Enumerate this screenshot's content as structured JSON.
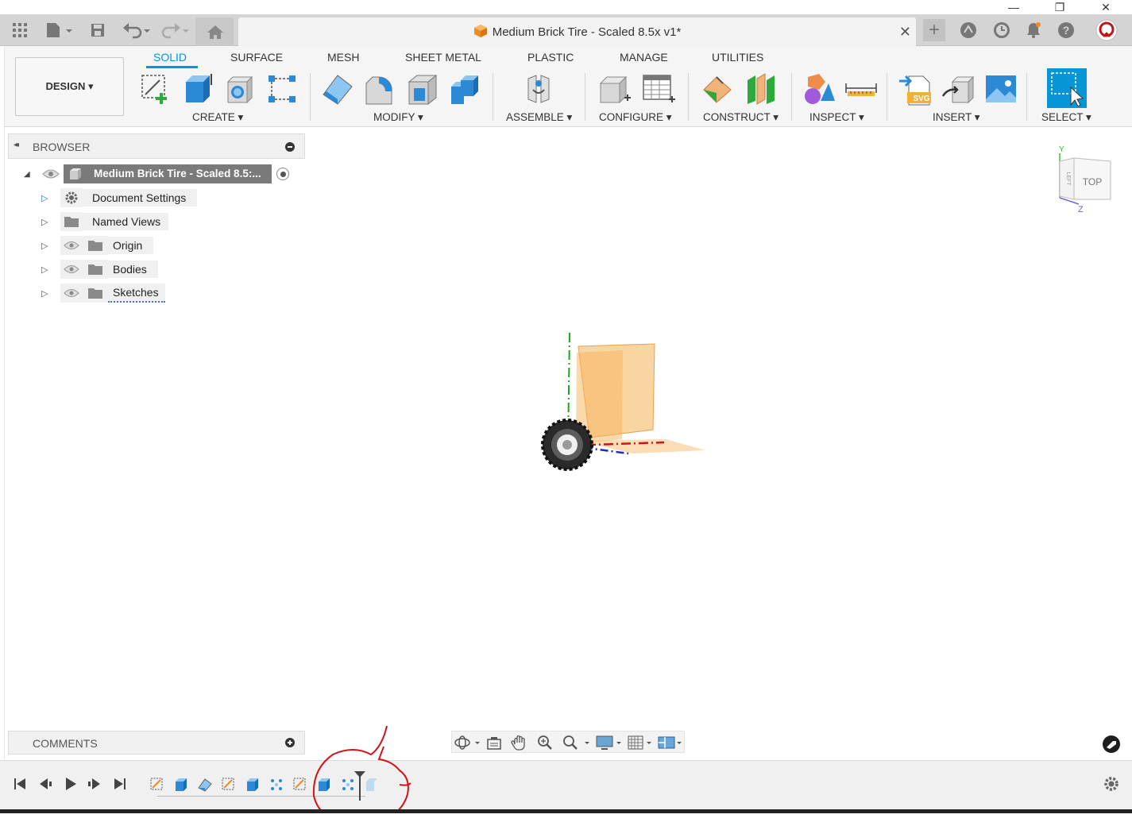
{
  "window": {
    "minimize_glyph": "—",
    "restore_glyph": "❐",
    "close_glyph": "✕"
  },
  "tabbar": {
    "document_title": "Medium Brick Tire - Scaled 8.5x v1*",
    "close_glyph": "✕",
    "new_tab_glyph": "+",
    "icons": [
      "grid-icon",
      "file-icon",
      "save-icon",
      "undo-icon",
      "redo-icon",
      "home-icon",
      "extensions-icon",
      "job-status-icon",
      "notifications-icon",
      "help-icon",
      "user-avatar-icon"
    ]
  },
  "ribbon": {
    "workspace": "DESIGN ▾",
    "tabs": [
      {
        "label": "SOLID",
        "active": true
      },
      {
        "label": "SURFACE"
      },
      {
        "label": "MESH"
      },
      {
        "label": "SHEET METAL"
      },
      {
        "label": "PLASTIC"
      },
      {
        "label": "MANAGE"
      },
      {
        "label": "UTILITIES"
      }
    ],
    "groups": {
      "create": "CREATE ▾",
      "modify": "MODIFY ▾",
      "assemble": "ASSEMBLE ▾",
      "configure": "CONFIGURE ▾",
      "construct": "CONSTRUCT ▾",
      "inspect": "INSPECT ▾",
      "insert": "INSERT ▾",
      "select": "SELECT ▾"
    },
    "svg_badge": "SVG",
    "accent_color": "#0696d7"
  },
  "browser": {
    "header": "BROWSER",
    "collapse_glyph": "◂◂",
    "root": "Medium Brick Tire - Scaled 8.5:...",
    "items": [
      {
        "label": "Document Settings"
      },
      {
        "label": "Named Views"
      },
      {
        "label": "Origin"
      },
      {
        "label": "Bodies"
      },
      {
        "label": "Sketches"
      }
    ]
  },
  "viewcube": {
    "top": "TOP",
    "left": "LEFT",
    "axis_y": "Y",
    "axis_z": "Z"
  },
  "comments": {
    "header": "COMMENTS"
  },
  "colors": {
    "annotation": "#d0141a",
    "plane_fill": "#f5b35a",
    "axis_x": "#d0141a",
    "axis_y": "#1aa51a",
    "axis_z": "#1a2ad0"
  }
}
